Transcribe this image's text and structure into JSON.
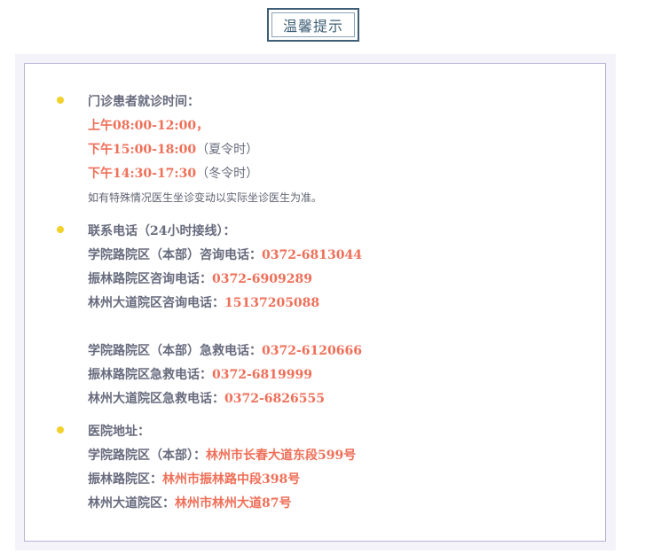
{
  "title": "温馨提示",
  "hours": {
    "heading": "门诊患者就诊时间：",
    "morning": "上午08:00-12:00，",
    "afternoon_summer": "下午15:00-18:00",
    "summer_tag": "（夏令时）",
    "afternoon_winter": "下午14:30-17:30",
    "winter_tag": "（冬令时）",
    "note": "如有特殊情况医生坐诊变动以实际坐诊医生为准。"
  },
  "contacts": {
    "heading": "联系电话（24小时接线）：",
    "consult": [
      {
        "label": "学院路院区（本部）咨询电话：",
        "value": "0372-6813044"
      },
      {
        "label": "振林路院区咨询电话：",
        "value": "0372-6909289"
      },
      {
        "label": "林州大道院区咨询电话：",
        "value": "15137205088"
      }
    ],
    "emergency": [
      {
        "label": "学院路院区（本部）急救电话：",
        "value": "0372-6120666"
      },
      {
        "label": "振林路院区急救电话：",
        "value": "0372-6819999"
      },
      {
        "label": "林州大道院区急救电话：",
        "value": "0372-6826555"
      }
    ]
  },
  "address": {
    "heading": "医院地址：",
    "items": [
      {
        "label": "学院路院区（本部）：",
        "value": "林州市长春大道东段599号"
      },
      {
        "label": "振林路院区：",
        "value": "林州市振林路中段398号"
      },
      {
        "label": "林州大道院区：",
        "value": "林州市林州大道87号"
      }
    ]
  },
  "colors": {
    "title_border": "#3e5f76",
    "panel_bg": "#f3f3f9",
    "panel_border": "#b8b3d4",
    "bullet": "#f2d12a",
    "text": "#676b7d",
    "accent": "#ef6f58"
  }
}
